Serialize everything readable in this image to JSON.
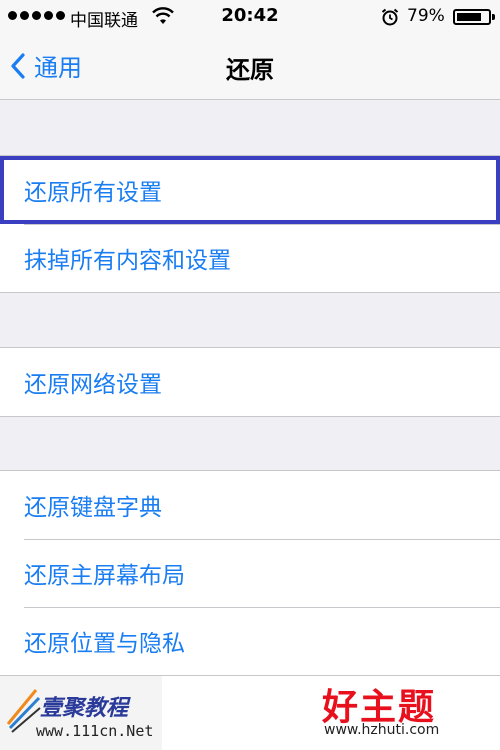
{
  "status_bar": {
    "carrier": "中国联通",
    "time": "20:42",
    "battery_percent": "79%",
    "battery_level": 0.79
  },
  "nav": {
    "back_label": "通用",
    "title": "还原"
  },
  "groups": [
    {
      "items": [
        {
          "label": "还原所有设置",
          "selected": true
        },
        {
          "label": "抹掉所有内容和设置"
        }
      ]
    },
    {
      "items": [
        {
          "label": "还原网络设置"
        }
      ]
    },
    {
      "items": [
        {
          "label": "还原键盘字典"
        },
        {
          "label": "还原主屏幕布局"
        },
        {
          "label": "还原位置与隐私"
        }
      ]
    }
  ],
  "watermarks": {
    "left_brand": "壹聚教程",
    "left_url": "www.111cn.Net",
    "right_brand": "好主题",
    "right_url": "www.hzhuti.com"
  },
  "colors": {
    "accent": "#1a7ef2",
    "highlight_border": "#3a3fc1",
    "background": "#efeff4"
  }
}
